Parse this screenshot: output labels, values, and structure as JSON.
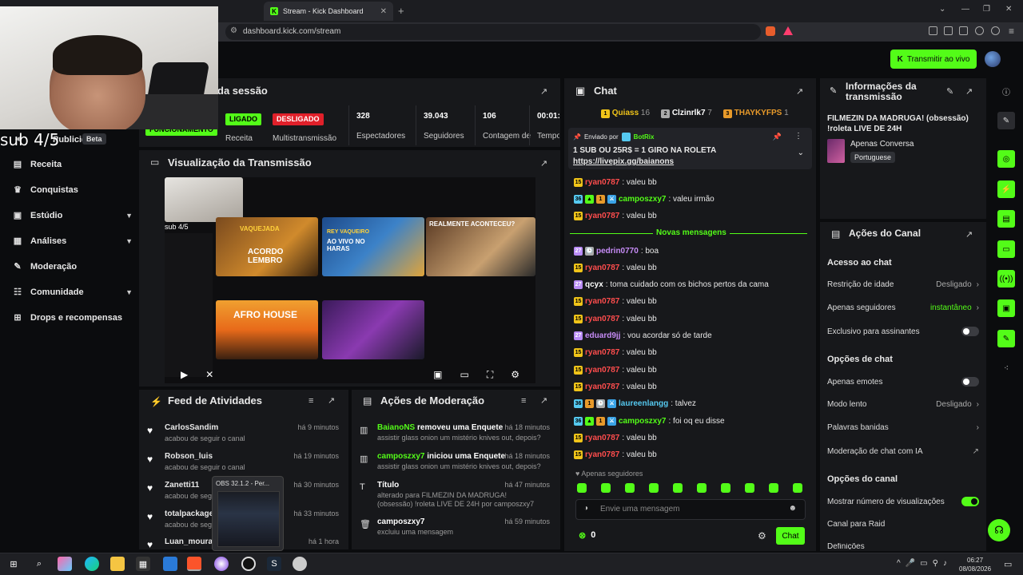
{
  "browser": {
    "tab_title": "Stream - Kick Dashboard",
    "url": "dashboard.kick.com/stream"
  },
  "header": {
    "go_live_label": "Transmitir ao vivo"
  },
  "webcam_overlay_text": "sub 4/5",
  "sidebar": {
    "items": [
      {
        "label": "Publicidade",
        "badge": "Beta"
      },
      {
        "label": "Receita"
      },
      {
        "label": "Conquistas"
      },
      {
        "label": "Estúdio"
      },
      {
        "label": "Análises"
      },
      {
        "label": "Moderação"
      },
      {
        "label": "Comunidade"
      },
      {
        "label": "Drops e recompensas"
      }
    ]
  },
  "session": {
    "title": "da sessão",
    "status_on": "LIGADO",
    "status_off": "DESLIGADO",
    "status_op": "FUNCIONAMENTO",
    "labels": [
      "Sessão",
      "Receita",
      "Multistransmissão",
      "Espectadores",
      "Seguidores",
      "Contagem de",
      "Tempo Ao Vivo"
    ],
    "spectators": "328",
    "followers": "39.043",
    "count": "106",
    "uptime": "00:01:"
  },
  "preview": {
    "title": "Visualização da Transmissão",
    "overlay_text": "sub 4/5",
    "thumb1": "ACORDO LEMBRO",
    "thumb1_top": "VAQUEJADA",
    "thumb2": "AO VIVO NO HARAS",
    "thumb2_top": "REY VAQUEIRO",
    "thumb3": "REALMENTE ACONTECEU?",
    "thumb4": "AFRO HOUSE"
  },
  "feed": {
    "title": "Feed de Atividades",
    "rows": [
      {
        "name": "CarlosSandim",
        "sub": "acabou de seguir o canal",
        "time": "há 9 minutos"
      },
      {
        "name": "Robson_luis",
        "sub": "acabou de seguir o canal",
        "time": "há 19 minutos"
      },
      {
        "name": "Zanetti11",
        "sub": "acabou de segui",
        "time": "há 30 minutos"
      },
      {
        "name": "totalpackage",
        "sub": "acabou de segu",
        "time": "há 33 minutos"
      },
      {
        "name": "Luan_moura",
        "sub": "",
        "time": "há 1 hora"
      }
    ],
    "obs_label": "OBS 32.1.2 - Per..."
  },
  "moderation": {
    "title": "Ações de Moderação",
    "rows": [
      {
        "user": "BaianoNS",
        "action": " removeu uma Enquete",
        "sub": "assistir glass onion um mistério knives out, depois?",
        "time": "há 18 minutos"
      },
      {
        "user": "camposzxy7",
        "action": " iniciou uma Enquete",
        "sub": "assistir glass onion um mistério knives out, depois?",
        "time": "há 18 minutos"
      },
      {
        "user": "",
        "action": "Título",
        "sub": "alterado para FILMEZIN DA MADRUGA! (obsessão) !roleta LIVE DE 24H por camposzxy7",
        "time": "há 47 minutos"
      },
      {
        "user": "",
        "action": "camposzxy7",
        "sub": "excluiu uma mensagem",
        "time": "há 59 minutos"
      }
    ]
  },
  "chat": {
    "title": "Chat",
    "top_gifters": [
      {
        "name": "Quiass",
        "count": "16"
      },
      {
        "name": "Clzinrlk7",
        "count": "7"
      },
      {
        "name": "THAYKYFPS",
        "count": "1"
      }
    ],
    "pinned": {
      "sent_by": "Enviado por",
      "author": "BotRix",
      "line1": "1 SUB OU 25R$ = 1 GIRO NA ROLETA",
      "line2": "https://livepix.gg/baianons"
    },
    "new_messages_label": "Novas mensagens",
    "messages_before": [
      {
        "user": "ryan0787",
        "text": ": valeu bb",
        "color": "#ff4d4d",
        "badges": [
          "sub"
        ]
      },
      {
        "user": "camposzxy7",
        "text": ": valeu irmão",
        "color": "#53fc18",
        "badges": [
          "blue",
          "vip",
          "og",
          "mod"
        ]
      },
      {
        "user": "ryan0787",
        "text": ": valeu bb",
        "color": "#ff4d4d",
        "badges": [
          "sub"
        ]
      }
    ],
    "messages_after": [
      {
        "user": "pedrin0770",
        "text": ": boa",
        "color": "#c78cf7",
        "badges": [
          "pur",
          "gray"
        ]
      },
      {
        "user": "ryan0787",
        "text": ": valeu bb",
        "color": "#ff4d4d",
        "badges": [
          "sub"
        ]
      },
      {
        "user": "qcyx",
        "text": ": toma cuidado com os bichos pertos da cama",
        "color": "#ffffff",
        "badges": [
          "pur"
        ]
      },
      {
        "user": "ryan0787",
        "text": ": valeu bb",
        "color": "#ff4d4d",
        "badges": [
          "sub"
        ]
      },
      {
        "user": "ryan0787",
        "text": ": valeu bb",
        "color": "#ff4d4d",
        "badges": [
          "sub"
        ]
      },
      {
        "user": "eduard9jj",
        "text": ": vou acordar só de tarde",
        "color": "#c78cf7",
        "badges": [
          "pur"
        ]
      },
      {
        "user": "ryan0787",
        "text": ": valeu bb",
        "color": "#ff4d4d",
        "badges": [
          "sub"
        ]
      },
      {
        "user": "ryan0787",
        "text": ": valeu bb",
        "color": "#ff4d4d",
        "badges": [
          "sub"
        ]
      },
      {
        "user": "ryan0787",
        "text": ": valeu bb",
        "color": "#ff4d4d",
        "badges": [
          "sub"
        ]
      },
      {
        "user": "laureenlangg",
        "text": ": talvez",
        "color": "#55c9f0",
        "badges": [
          "blue",
          "og",
          "gray",
          "mod"
        ]
      },
      {
        "user": "camposzxy7",
        "text": ": foi oq eu disse",
        "color": "#53fc18",
        "badges": [
          "blue",
          "vip",
          "og",
          "mod"
        ]
      },
      {
        "user": "ryan0787",
        "text": ": valeu bb",
        "color": "#ff4d4d",
        "badges": [
          "sub"
        ]
      },
      {
        "user": "ryan0787",
        "text": ": valeu bb",
        "color": "#ff4d4d",
        "badges": [
          "sub"
        ]
      }
    ],
    "followers_only_hint": "Apenas seguidores",
    "input_placeholder": "Envie uma mensagem",
    "kicks": "0",
    "send_label": "Chat"
  },
  "info": {
    "title": "Informações da transmissão",
    "stream_title": "FILMEZIN DA MADRUGA! (obsessão) !roleta LIVE DE 24H",
    "category": "Apenas Conversa",
    "language": "Portuguese"
  },
  "channel_actions": {
    "title": "Ações do Canal",
    "chat_access": "Acesso ao chat",
    "age_restriction": "Restrição de idade",
    "age_value": "Desligado",
    "followers_only": "Apenas seguidores",
    "followers_value": "instantâneo",
    "subs_only": "Exclusivo para assinantes",
    "chat_options": "Opções de chat",
    "emotes_only": "Apenas emotes",
    "slow_mode": "Modo lento",
    "slow_value": "Desligado",
    "banned_words": "Palavras banidas",
    "ai_mod": "Moderação de chat com IA",
    "channel_options": "Opções do canal",
    "show_views": "Mostrar número de visualizações",
    "raid": "Canal para Raid",
    "settings": "Definições"
  },
  "taskbar": {
    "time": "06:27",
    "date": "08/08/2026"
  },
  "colors": {
    "accent": "#53fc18",
    "panel": "#17181b",
    "bg": "#0b0c0e"
  }
}
